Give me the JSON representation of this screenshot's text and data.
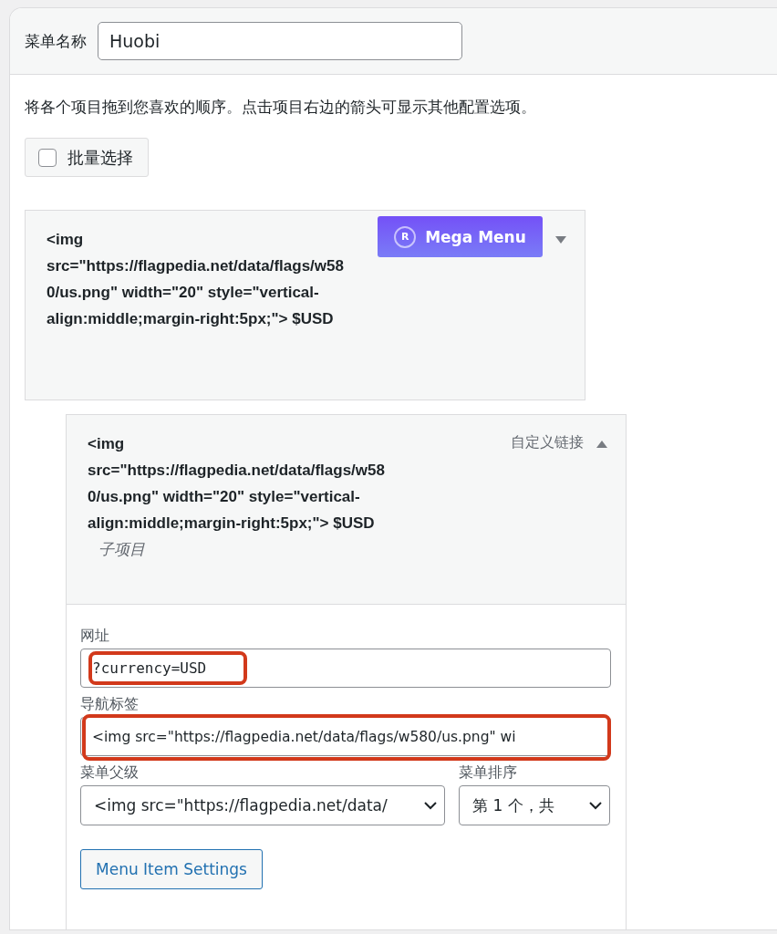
{
  "menu_name": {
    "label": "菜单名称",
    "value": "Huobi"
  },
  "instructions": "将各个项目拖到您喜欢的顺序。点击项目右边的箭头可显示其他配置选项。",
  "bulk_select": {
    "label": "批量选择",
    "checked": false
  },
  "items": [
    {
      "title": "<img src=\"https://flagpedia.net/data/flags/w580/us.png\" width=\"20\" style=\"vertical-align:middle;margin-right:5px;\"> $USD",
      "badge": {
        "icon": "R",
        "label": "Mega Menu"
      },
      "expanded": false
    },
    {
      "title": "<img src=\"https://flagpedia.net/data/flags/w580/us.png\" width=\"20\" style=\"vertical-align:middle;margin-right:5px;\"> $USD",
      "expanded": true,
      "sub_label": "子项目",
      "type_label": "自定义链接",
      "settings": {
        "url": {
          "label": "网址",
          "value": "?currency=USD"
        },
        "nav_label": {
          "label": "导航标签",
          "value": "<img src=\"https://flagpedia.net/data/flags/w580/us.png\" wi"
        },
        "parent": {
          "label": "菜单父级",
          "value": "<img src=\"https://flagpedia.net/data/"
        },
        "order": {
          "label": "菜单排序",
          "value": "第 1 个，共"
        },
        "button": "Menu Item Settings"
      }
    }
  ]
}
